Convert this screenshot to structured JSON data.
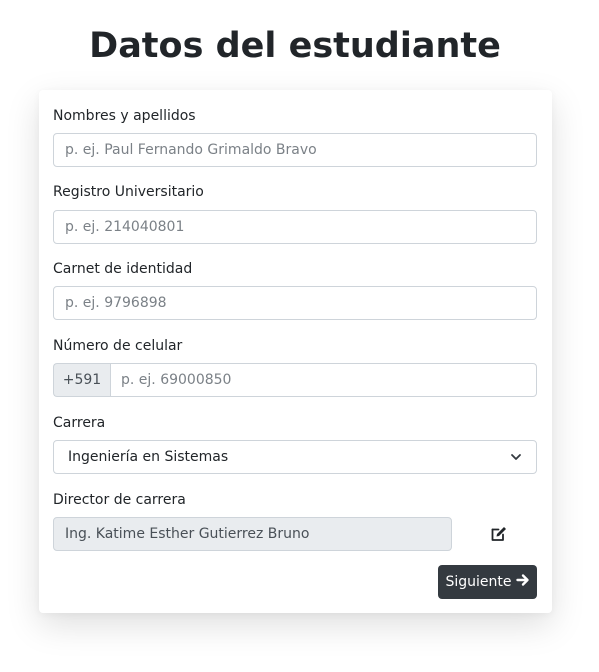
{
  "page": {
    "title": "Datos del estudiante"
  },
  "form": {
    "full_name": {
      "label": "Nombres y apellidos",
      "placeholder": "p. ej. Paul Fernando Grimaldo Bravo",
      "value": ""
    },
    "university_registry": {
      "label": "Registro Universitario",
      "placeholder": "p. ej. 214040801",
      "value": ""
    },
    "identity_card": {
      "label": "Carnet de identidad",
      "placeholder": "p. ej. 9796898",
      "value": ""
    },
    "phone": {
      "label": "Número de celular",
      "prefix": "+591",
      "placeholder": "p. ej. 69000850",
      "value": ""
    },
    "career": {
      "label": "Carrera",
      "selected": "Ingeniería en Sistemas"
    },
    "director": {
      "label": "Director de carrera",
      "value": "Ing. Katime Esther Gutierrez Bruno",
      "edit_icon": "edit-icon"
    },
    "next_button": {
      "label": "Siguiente",
      "icon": "arrow-right-icon"
    }
  },
  "colors": {
    "button_bg": "#343a40",
    "readonly_bg": "#e9ecef",
    "border": "#ced4da"
  }
}
